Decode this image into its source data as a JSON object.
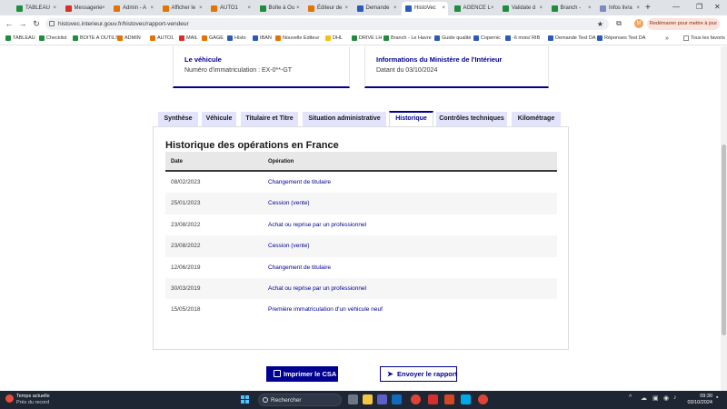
{
  "browser": {
    "tabs": [
      {
        "label": "TABLEAU",
        "color": "#1e8e3e"
      },
      {
        "label": "Messagerie",
        "color": "#d93025"
      },
      {
        "label": "Admin - A",
        "color": "#e37400"
      },
      {
        "label": "Afficher le",
        "color": "#e37400"
      },
      {
        "label": "AUTO1",
        "color": "#e37400"
      },
      {
        "label": "Boîte à Ou",
        "color": "#1e8e3e"
      },
      {
        "label": "Éditeur de",
        "color": "#e37400"
      },
      {
        "label": "Demande",
        "color": "#2b5bb8"
      },
      {
        "label": "HistoVec",
        "color": "#2b5bb8"
      },
      {
        "label": "AGENCE L",
        "color": "#1e8e3e"
      },
      {
        "label": "Validate d",
        "color": "#1e8e3e"
      },
      {
        "label": "Branch -",
        "color": "#1e8e3e"
      },
      {
        "label": "Infos livra",
        "color": "#7b8cbf"
      }
    ],
    "active_tab_index": 8,
    "new_tab": "+",
    "url": "histovec.interieur.gouv.fr/histovec/rapport-vendeur",
    "profile_initial": "M",
    "restart_label": "Redémarrer pour mettre à jour",
    "bookmarks": [
      {
        "label": "TABLEAU",
        "color": "#1e8e3e"
      },
      {
        "label": "Checklist",
        "color": "#1e8e3e"
      },
      {
        "label": "BOITE A OUTILS",
        "color": "#1e8e3e"
      },
      {
        "label": "ADMIN",
        "color": "#e37400"
      },
      {
        "label": "AUTO1",
        "color": "#e37400"
      },
      {
        "label": "MAIL",
        "color": "#d93025"
      },
      {
        "label": "GAGE",
        "color": "#e37400"
      },
      {
        "label": "Histo",
        "color": "#2b5bb8"
      },
      {
        "label": "IBAN",
        "color": "#2b5bb8"
      },
      {
        "label": "Nouvelle Editeur",
        "color": "#e37400"
      },
      {
        "label": "DHL",
        "color": "#f4c20d"
      },
      {
        "label": "DRIVE LH",
        "color": "#1e8e3e"
      },
      {
        "label": "Branch - Le Havre",
        "color": "#1e8e3e"
      },
      {
        "label": "Guide qualité",
        "color": "#2b5bb8"
      },
      {
        "label": "Copernic",
        "color": "#2b5bb8"
      },
      {
        "label": "-6 mois/ RIB",
        "color": "#2b5bb8"
      },
      {
        "label": "Demande Test DA",
        "color": "#2b5bb8"
      },
      {
        "label": "Réponses Test DA",
        "color": "#2b5bb8"
      }
    ],
    "all_bookmarks": "Tous les favoris"
  },
  "page": {
    "vehicle_card": {
      "title": "Le véhicule",
      "text": "Numéro d'immatriculation : EX-0**-GT"
    },
    "ministry_card": {
      "title": "Informations du Ministère de l'Intérieur",
      "text": "Datant du 03/10/2024"
    },
    "tabs": [
      "Synthèse",
      "Véhicule",
      "Titulaire et Titre",
      "Situation administrative",
      "Historique",
      "Contrôles techniques",
      "Kilométrage"
    ],
    "active_tab_index": 4,
    "history_title": "Historique des opérations en France",
    "table": {
      "col_date": "Date",
      "col_operation": "Opération",
      "rows": [
        {
          "date": "08/02/2023",
          "operation": "Changement de titulaire"
        },
        {
          "date": "25/01/2023",
          "operation": "Cession (vente)"
        },
        {
          "date": "23/08/2022",
          "operation": "Achat ou reprise par un professionnel"
        },
        {
          "date": "23/08/2022",
          "operation": "Cession (vente)"
        },
        {
          "date": "12/06/2019",
          "operation": "Changement de titulaire"
        },
        {
          "date": "30/03/2019",
          "operation": "Achat ou reprise par un professionnel"
        },
        {
          "date": "15/05/2018",
          "operation": "Première immatriculation d'un véhicule neuf"
        }
      ]
    },
    "print_button": "Imprimer le CSA",
    "send_button": "Envoyer le rapport"
  },
  "taskbar": {
    "weather_title": "Temps actuelle",
    "weather_sub": "Près du record",
    "search_placeholder": "Rechercher",
    "time": "09:30",
    "date": "03/10/2024"
  }
}
